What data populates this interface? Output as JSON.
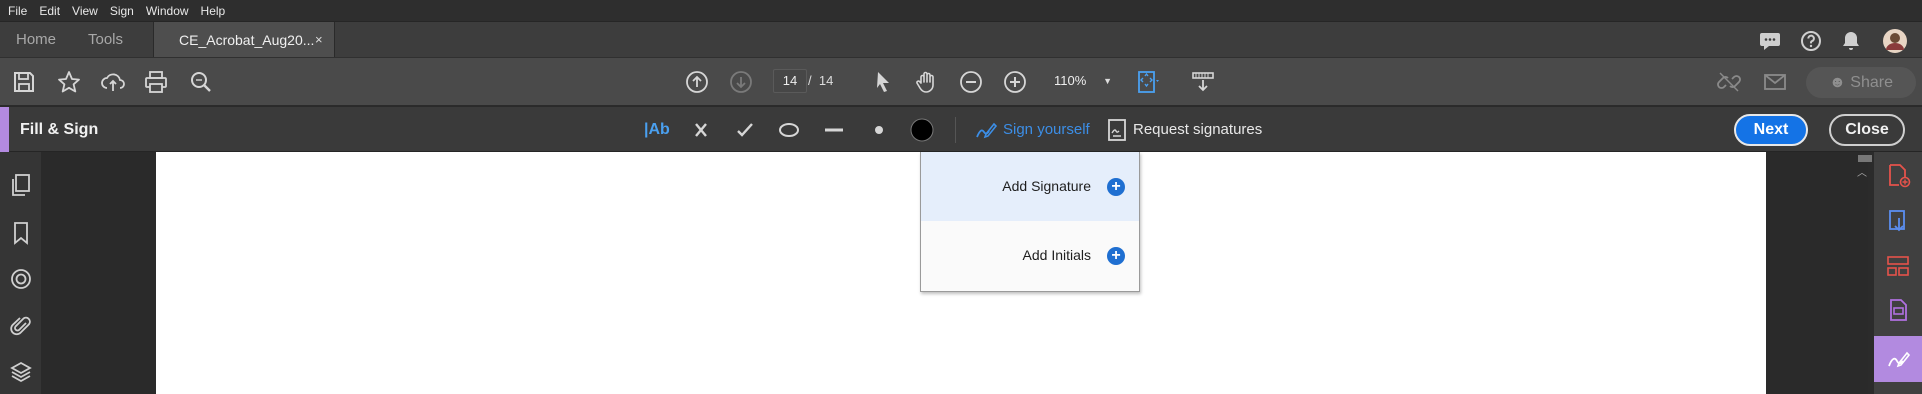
{
  "menubar": {
    "items": [
      "File",
      "Edit",
      "View",
      "Sign",
      "Window",
      "Help"
    ]
  },
  "tabs": {
    "home": "Home",
    "tools": "Tools",
    "document": "CE_Acrobat_Aug20...",
    "close_glyph": "×"
  },
  "toolbar": {
    "page_current": "14",
    "page_separator": "/",
    "page_total": "14",
    "zoom": "110%",
    "share_label": "Share"
  },
  "fillsign": {
    "title": "Fill & Sign",
    "text_tool": "|Ab",
    "sign_yourself": "Sign yourself",
    "request_signatures": "Request signatures",
    "next_label": "Next",
    "close_label": "Close"
  },
  "sign_menu": {
    "items": [
      {
        "label": "Add Signature",
        "highlighted": true
      },
      {
        "label": "Add Initials",
        "highlighted": false
      }
    ]
  },
  "colors": {
    "accent": "#b38ae0",
    "primary": "#1473e6",
    "link": "#3c8ee6"
  }
}
